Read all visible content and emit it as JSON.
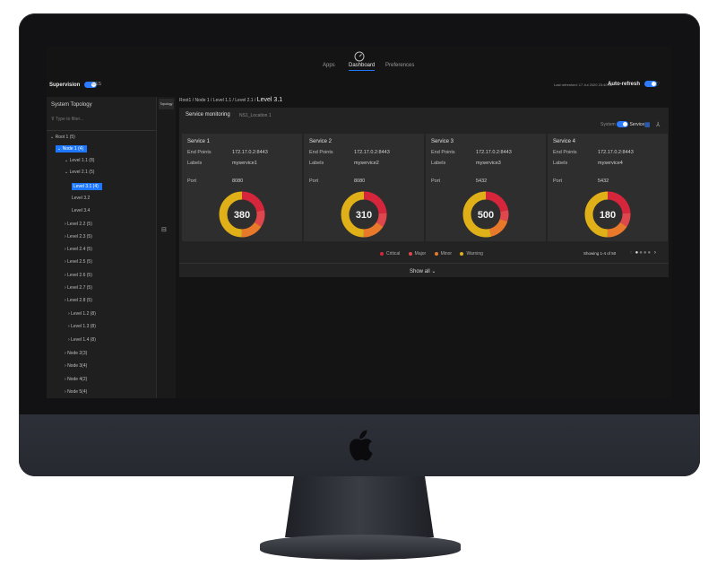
{
  "nav": {
    "apps": "Apps",
    "dashboard": "Dashboard",
    "preferences": "Preferences"
  },
  "header": {
    "supervision": "Supervision",
    "ees": "EES",
    "last_refreshed": "Last refreshed: 17 Jul 2020 23:40:05",
    "auto_refresh": "Auto-refresh"
  },
  "sidebar": {
    "title": "System Topology",
    "filter_placeholder": "Type to filter...",
    "topology_tab": "Topology",
    "tree": [
      "Root 1 (5)",
      "Node 1 (4)",
      "Level 1.1 (8)",
      "Level 2.1 (5)",
      "Level 3.1 (4)",
      "Level 3.2",
      "Level 3.4",
      "Level 2.2 (5)",
      "Level 2.3 (5)",
      "Level 2.4 (5)",
      "Level 2.5 (5)",
      "Level 2.6 (5)",
      "Level 2.7 (5)",
      "Level 2.8 (5)",
      "Level 1.2 (8)",
      "Level 1.3 (8)",
      "Level 1.4 (8)",
      "Node 2(3)",
      "Node 3(4)",
      "Node 4(2)",
      "Node 5(4)"
    ]
  },
  "breadcrumb": {
    "items": [
      "Root1",
      "Node 1",
      "Level 1.1",
      "Level 2.1"
    ],
    "current": "Level 3.1"
  },
  "panel": {
    "title": "Service monitoring",
    "subtitle": "NS1_Location 1",
    "system_label": "System",
    "service_label": "Service",
    "show_all": "Show all",
    "showing": "Showing 1-4 of 50"
  },
  "labels": {
    "end_points": "End Points",
    "labels": "Labels",
    "port": "Port"
  },
  "services": [
    {
      "name": "Service 1",
      "endpoint": "172.17.0.2:8443",
      "label": "myservice1",
      "port": "8080",
      "total": "380"
    },
    {
      "name": "Service 2",
      "endpoint": "172.17.0.2:8443",
      "label": "myservice2",
      "port": "8080",
      "total": "310"
    },
    {
      "name": "Service 3",
      "endpoint": "172.17.0.2:8443",
      "label": "myservice3",
      "port": "5432",
      "total": "500"
    },
    {
      "name": "Service 4",
      "endpoint": "172.17.0.2:8443",
      "label": "myservice4",
      "port": "5432",
      "total": "180"
    }
  ],
  "legend": [
    {
      "label": "Critical",
      "color": "#d6263c"
    },
    {
      "label": "Major",
      "color": "#e0474c"
    },
    {
      "label": "Minor",
      "color": "#e8782a"
    },
    {
      "label": "Warning",
      "color": "#e0b018"
    }
  ],
  "colors": {
    "accent": "#1e78ff"
  },
  "icons": [
    "dashboard-gauge-icon",
    "filter-icon",
    "heart-icon",
    "grid-view-icon",
    "hierarchy-icon",
    "chevron-down-icon",
    "chevron-right-icon",
    "apple-logo"
  ]
}
